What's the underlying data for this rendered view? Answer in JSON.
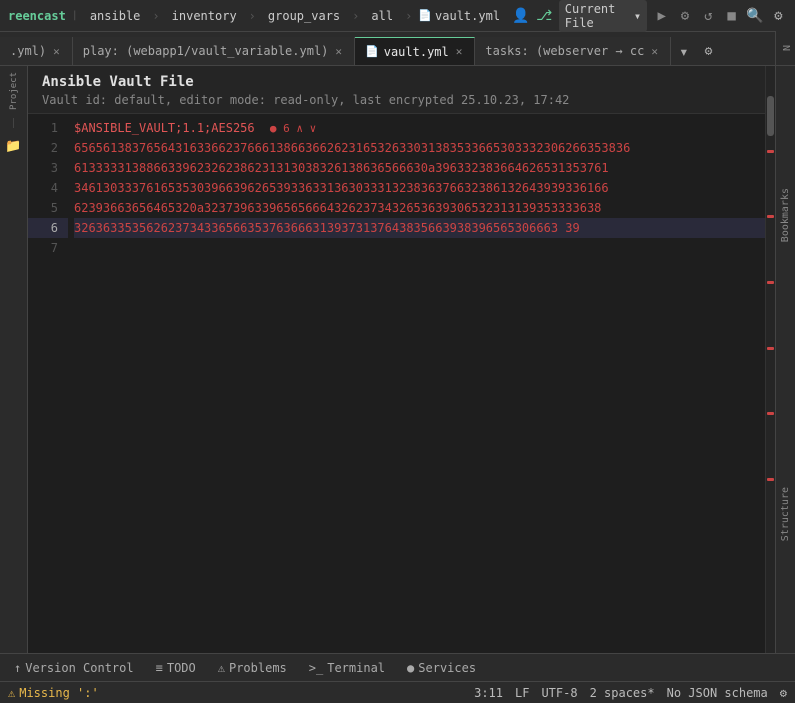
{
  "app": {
    "title": "reencast"
  },
  "toolbar": {
    "items": [
      "ansible",
      "inventory",
      "group_vars",
      "all"
    ],
    "file_icon": "📄",
    "vault_yml": "vault.yml",
    "user_icon": "👤",
    "branch_icon": "⎇",
    "current_file_label": "Current File",
    "dropdown_arrow": "▾",
    "run_icon": "▶",
    "build_icon": "⚙",
    "history_icon": "↺",
    "stop_icon": "■",
    "search_icon": "🔍",
    "settings_icon": "⚙"
  },
  "tabs": [
    {
      "label": ".yml)",
      "active": false,
      "closeable": true
    },
    {
      "label": "play: (webapp1/vault_variable.yml)",
      "active": false,
      "closeable": true
    },
    {
      "label": "vault.yml",
      "active": true,
      "closeable": true
    },
    {
      "label": "tasks: (webserver → cc",
      "active": false,
      "closeable": true
    }
  ],
  "file_header": {
    "title": "Ansible Vault File",
    "meta": "Vault id: default, editor mode: read-only, last encrypted 25.10.23, 17:42"
  },
  "code": {
    "lines": [
      {
        "num": 1,
        "content": "$ANSIBLE_VAULT;1.1;AES256",
        "type": "bright-red",
        "error": true
      },
      {
        "num": 2,
        "content": "65656138376564316336623766613866366262316532633031383533665303332306266353836",
        "type": "red"
      },
      {
        "num": 3,
        "content": "6133333138866339623262386231313038326138636566630a396332383664626531353761",
        "type": "red"
      },
      {
        "num": 4,
        "content": "34613033376165353039663962653933633136303331323836376632386132643939336166",
        "type": "red"
      },
      {
        "num": 5,
        "content": "62393663656465320a3237396339656566643262373432653639306532313139353333638",
        "type": "red"
      },
      {
        "num": 6,
        "content": "3263633535626237343365663537636663139373137643835663938396565306663 39",
        "type": "red",
        "active": true
      },
      {
        "num": 7,
        "content": "",
        "type": "normal"
      }
    ],
    "error_count": 6
  },
  "right_panel": {
    "labels": [
      "Bookmarks",
      "Structure"
    ]
  },
  "bottom_tabs": [
    {
      "label": "Version Control",
      "icon": "↑",
      "active": false
    },
    {
      "label": "TODO",
      "icon": "≡",
      "active": false
    },
    {
      "label": "Problems",
      "icon": "⚠",
      "active": false
    },
    {
      "label": "Terminal",
      "icon": ">_",
      "active": false
    },
    {
      "label": "Services",
      "icon": "●",
      "active": false
    }
  ],
  "status_bar": {
    "warning": "Missing ':'",
    "position": "3:11",
    "encoding": "LF",
    "charset": "UTF-8",
    "indent": "2 spaces*",
    "schema": "No JSON schema",
    "settings_icon": "⚙"
  }
}
